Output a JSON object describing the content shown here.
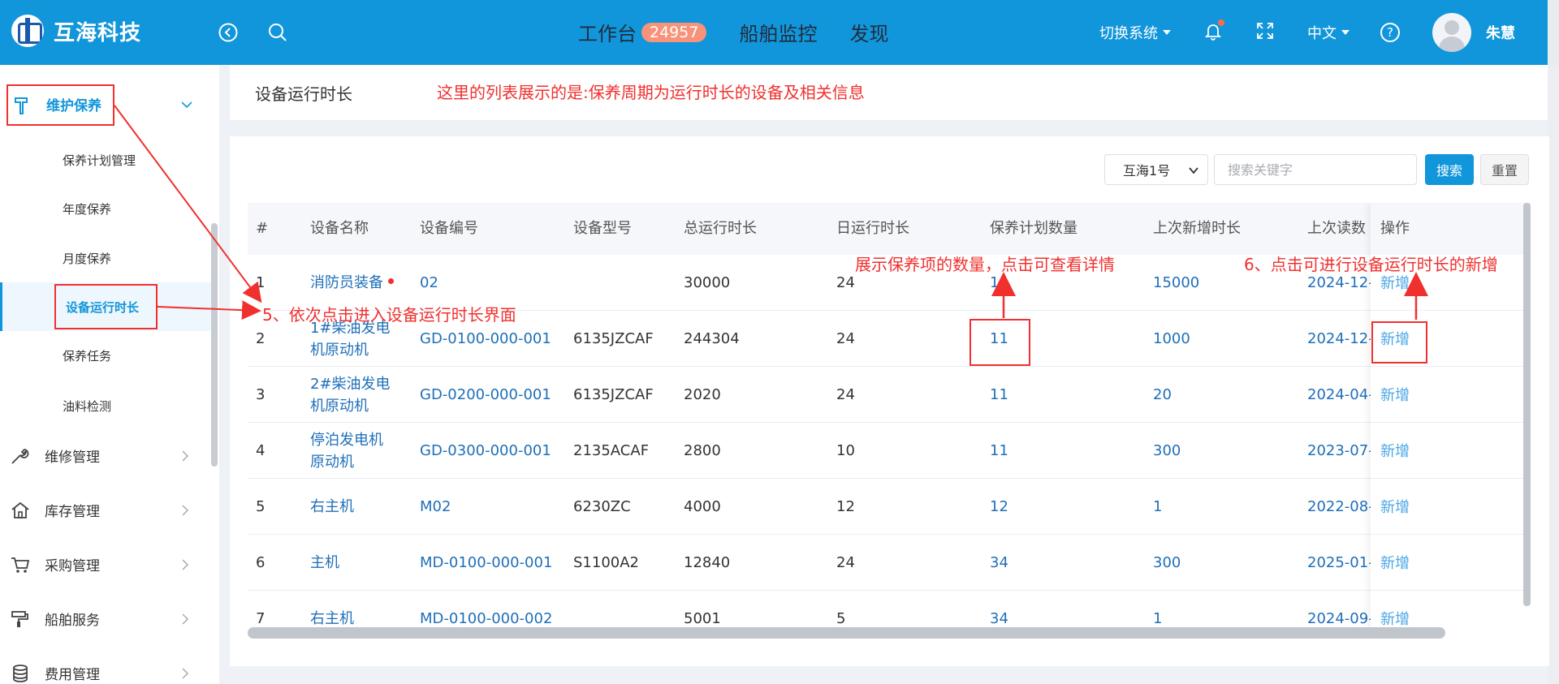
{
  "app": {
    "name": "互海科技"
  },
  "header": {
    "nav": [
      {
        "label": "工作台",
        "badge": "24957"
      },
      {
        "label": "船舶监控"
      },
      {
        "label": "发现"
      }
    ],
    "switch_system": "切换系统",
    "language": "中文",
    "help": "?",
    "user": "朱慧"
  },
  "sidebar": {
    "group": "维护保养",
    "sub_items": [
      "保养计划管理",
      "年度保养",
      "月度保养",
      "设备运行时长",
      "保养任务",
      "油料检测"
    ],
    "active": "设备运行时长",
    "main_items": [
      "维修管理",
      "库存管理",
      "采购管理",
      "船舶服务",
      "费用管理"
    ]
  },
  "page": {
    "title": "设备运行时长"
  },
  "filters": {
    "ship": "互海1号",
    "search_placeholder": "搜索关键字",
    "search_label": "搜索",
    "reset_label": "重置"
  },
  "table": {
    "headers": [
      "#",
      "设备名称",
      "设备编号",
      "设备型号",
      "总运行时长",
      "日运行时长",
      "保养计划数量",
      "上次新增时长",
      "上次读数",
      "操作"
    ],
    "rows": [
      {
        "no": "1",
        "name": "消防员装备",
        "code": "02",
        "model": "",
        "total": "30000",
        "daily": "24",
        "plans": "1",
        "last_add": "15000",
        "last_read": "2024-12-",
        "op": "新增"
      },
      {
        "no": "2",
        "name": "1#柴油发电机原动机",
        "code": "GD-0100-000-001",
        "model": "6135JZCAF",
        "total": "244304",
        "daily": "24",
        "plans": "11",
        "last_add": "1000",
        "last_read": "2024-12-",
        "op": "新增"
      },
      {
        "no": "3",
        "name": "2#柴油发电机原动机",
        "code": "GD-0200-000-001",
        "model": "6135JZCAF",
        "total": "2020",
        "daily": "24",
        "plans": "11",
        "last_add": "20",
        "last_read": "2024-04-",
        "op": "新增"
      },
      {
        "no": "4",
        "name": "停泊发电机原动机",
        "code": "GD-0300-000-001",
        "model": "2135ACAF",
        "total": "2800",
        "daily": "10",
        "plans": "11",
        "last_add": "300",
        "last_read": "2023-07-",
        "op": "新增"
      },
      {
        "no": "5",
        "name": "右主机",
        "code": "M02",
        "model": "6230ZC",
        "total": "4000",
        "daily": "12",
        "plans": "12",
        "last_add": "1",
        "last_read": "2022-08-",
        "op": "新增"
      },
      {
        "no": "6",
        "name": "主机",
        "code": "MD-0100-000-001",
        "model": "S1100A2",
        "total": "12840",
        "daily": "24",
        "plans": "34",
        "last_add": "300",
        "last_read": "2025-01-",
        "op": "新增"
      },
      {
        "no": "7",
        "name": "右主机",
        "code": "MD-0100-000-002",
        "model": "",
        "total": "5001",
        "daily": "5",
        "plans": "34",
        "last_add": "1",
        "last_read": "2024-09-",
        "op": "新增"
      }
    ]
  },
  "annotations": {
    "list_note": "这里的列表展示的是:保养周期为运行时长的设备及相关信息",
    "step5": "5、依次点击进入设备运行时长界面",
    "plans_note": "展示保养项的数量，点击可查看详情",
    "step6": "6、点击可进行设备运行时长的新增"
  },
  "colors": {
    "primary": "#1296db",
    "annotation": "#f0302e",
    "link": "#1f6fb8"
  }
}
